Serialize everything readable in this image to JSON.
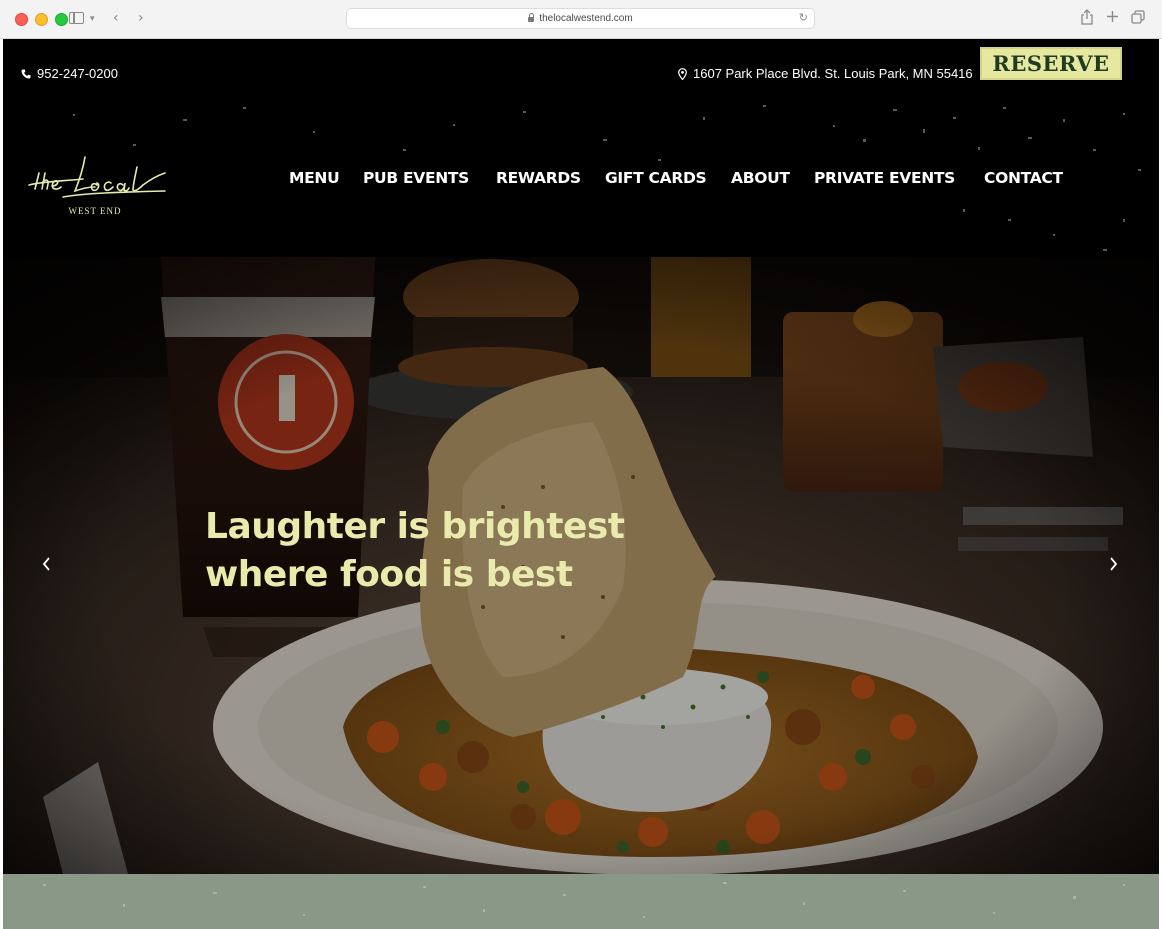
{
  "browser": {
    "url": "thelocalwestend.com"
  },
  "site": {
    "phone": "952-247-0200",
    "address": "1607 Park Place Blvd. St. Louis Park, MN 55416",
    "reserve_label": "RESERVE",
    "logo": {
      "script_text": "the Local",
      "subtitle": "WEST END"
    },
    "nav": [
      {
        "label": "MENU"
      },
      {
        "label": "PUB EVENTS"
      },
      {
        "label": "REWARDS"
      },
      {
        "label": "GIFT CARDS"
      },
      {
        "label": "ABOUT"
      },
      {
        "label": "PRIVATE EVENTS"
      },
      {
        "label": "CONTACT"
      }
    ]
  },
  "hero": {
    "headline_line1": "Laughter is brightest",
    "headline_line2": "where food is best",
    "prev_icon": "chevron-left-icon",
    "next_icon": "chevron-right-icon"
  },
  "colors": {
    "accent": "#e9ebad",
    "reserve_bg": "#e6e8a0",
    "reserve_text": "#1f3b22",
    "band": "#8a9887"
  }
}
